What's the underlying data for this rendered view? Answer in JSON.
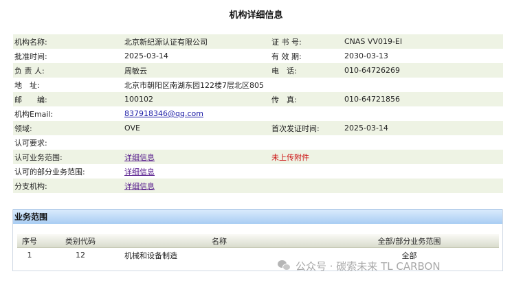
{
  "title": "机构详细信息",
  "info_rows": [
    {
      "l1": "机构名称:",
      "v1": "北京新纪源认证有限公司",
      "l2": "证 书 号:",
      "v2": "CNAS VV019-EI"
    },
    {
      "l1": "批准时间:",
      "v1": "2025-03-14",
      "l2": "有 效 期:",
      "v2": "2030-03-13"
    },
    {
      "l1": "负 责 人:",
      "v1": "周敏云",
      "l2": "电　话:",
      "v2": "010-64726269"
    },
    {
      "l1": "地　址:",
      "v1": "北京市朝阳区南湖东园122楼7层北区805",
      "l2": "",
      "v2": ""
    },
    {
      "l1": "邮　　编:",
      "v1": "100102",
      "l2": "传　真:",
      "v2": "010-64721856"
    },
    {
      "l1": "机构Email:",
      "v1": "837918346@qq.com",
      "l2": "",
      "v2": ""
    },
    {
      "l1": "领域:",
      "v1": "OVE",
      "l2": "首次发证时间:",
      "v2": "2025-03-14"
    },
    {
      "l1": "认可要求:",
      "v1": "",
      "l2": "",
      "v2": ""
    },
    {
      "l1": "认可业务范围:",
      "v1": "详细信息",
      "l2": "未上传附件",
      "v2": ""
    },
    {
      "l1": "认可的部分业务范围:",
      "v1": "详细信息",
      "l2": "",
      "v2": ""
    },
    {
      "l1": "分支机构:",
      "v1": "详细信息",
      "l2": "",
      "v2": ""
    }
  ],
  "scope": {
    "header": "业务范围",
    "columns": [
      "序号",
      "类别代码",
      "名称",
      "全部/部分业务范围"
    ],
    "rows": [
      [
        "1",
        "12",
        "机械和设备制造",
        "全部"
      ]
    ]
  },
  "watermark": "公众号 · 碳索未来 TL CARBON"
}
